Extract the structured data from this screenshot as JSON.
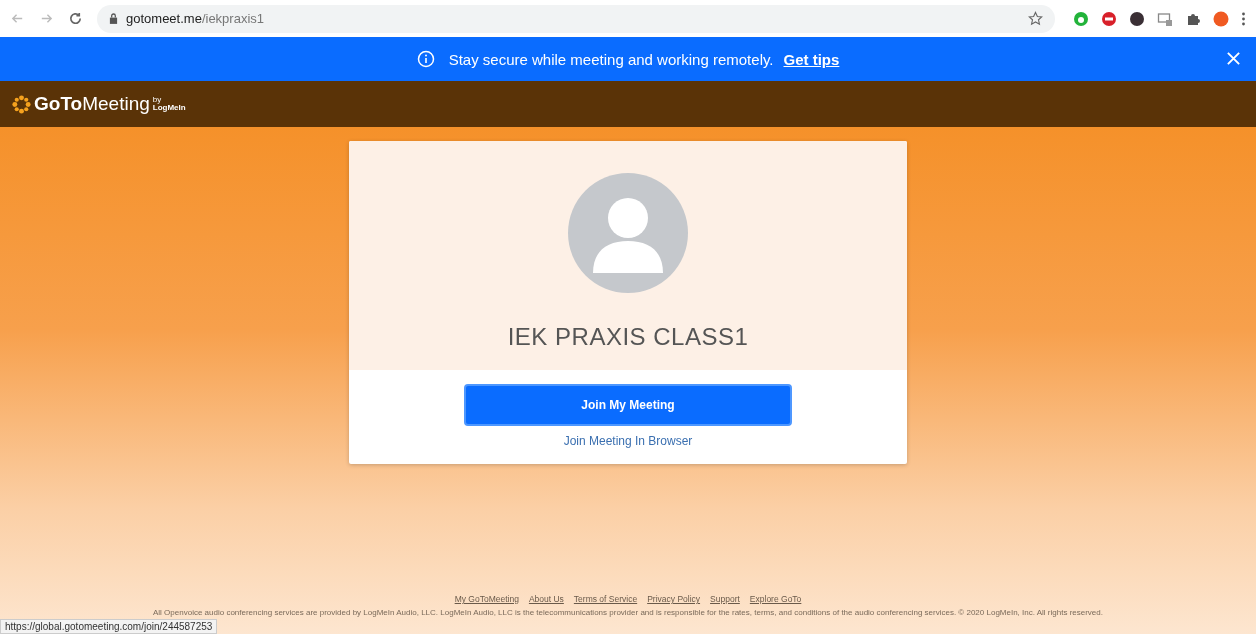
{
  "browser": {
    "url_host": "gotomeet.me",
    "url_path": "/iekpraxis1"
  },
  "banner": {
    "message": "Stay secure while meeting and working remotely.",
    "link": "Get tips"
  },
  "header": {
    "logo_bold": "GoTo",
    "logo_rest": "Meeting",
    "logo_by": "by",
    "logo_brand": "LogMeIn"
  },
  "card": {
    "name": "IEK PRAXIS CLASS1",
    "primary_button": "Join My Meeting",
    "secondary_link": "Join Meeting In Browser"
  },
  "footer": {
    "links": [
      "My GoToMeeting",
      "About Us",
      "Terms of Service",
      "Privacy Policy",
      "Support",
      "Explore GoTo"
    ],
    "legal": "All Openvoice audio conferencing services are provided by LogMeIn Audio, LLC. LogMeIn Audio, LLC is the telecommunications provider and is responsible for the rates, terms, and conditions of the audio conferencing services. © 2020 LogMeIn, Inc. All rights reserved."
  },
  "status_url": "https://global.gotomeeting.com/join/244587253"
}
